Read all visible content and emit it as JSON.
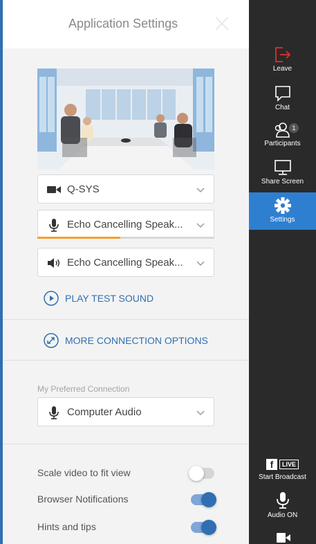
{
  "header": {
    "title": "Application Settings"
  },
  "devices": {
    "camera": {
      "value": "Q-SYS"
    },
    "microphone": {
      "value": "Echo Cancelling Speak...",
      "level": 0.47
    },
    "speaker": {
      "value": "Echo Cancelling Speak..."
    }
  },
  "links": {
    "play_test_sound": "PLAY TEST SOUND",
    "more_connection_options": "MORE CONNECTION OPTIONS"
  },
  "preferred_connection": {
    "label": "My Preferred Connection",
    "value": "Computer Audio"
  },
  "toggles": [
    {
      "label": "Scale video to fit view",
      "on": false
    },
    {
      "label": "Browser Notifications",
      "on": true
    },
    {
      "label": "Hints and tips",
      "on": true
    }
  ],
  "sidebar": {
    "leave": "Leave",
    "chat": "Chat",
    "participants": "Participants",
    "participants_count": "1",
    "share_screen": "Share Screen",
    "settings": "Settings",
    "live_badge": "LIVE",
    "start_broadcast": "Start Broadcast",
    "audio": "Audio ON"
  },
  "colors": {
    "accent": "#2f6fb2",
    "sidebar_bg": "#2a2a2a",
    "sidebar_active": "#2f7fd0",
    "leave_red": "#e0302a",
    "mic_level": "#f5a02a"
  },
  "icons": [
    "close-icon",
    "video-camera-icon",
    "microphone-icon",
    "speaker-icon",
    "chevron-down-icon",
    "play-icon",
    "connection-icon",
    "leave-icon",
    "chat-icon",
    "participants-icon",
    "share-screen-icon",
    "gear-icon",
    "facebook-icon",
    "video-icon"
  ]
}
